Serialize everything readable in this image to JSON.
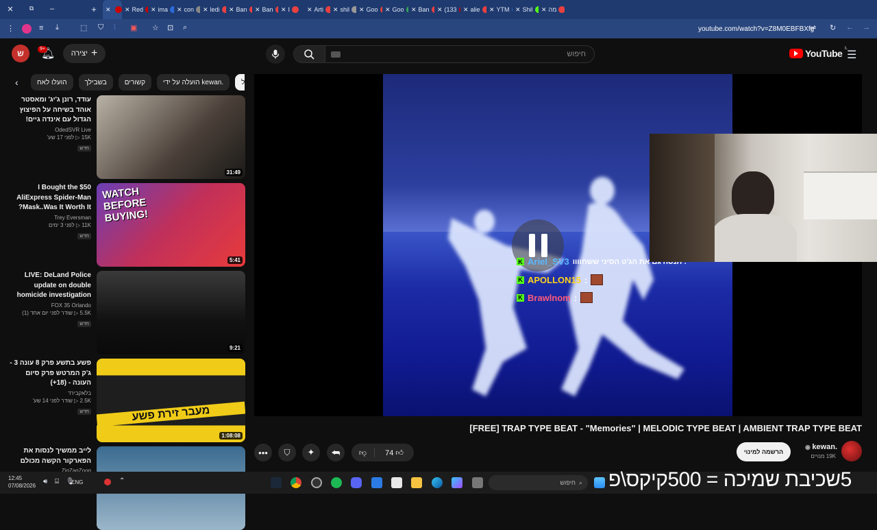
{
  "browser": {
    "tabs": [
      {
        "label": ""
      },
      {
        "label": "Red"
      },
      {
        "label": "ima"
      },
      {
        "label": "con"
      },
      {
        "label": "ledi"
      },
      {
        "label": "Ban"
      },
      {
        "label": "Ban"
      },
      {
        "label": "I"
      },
      {
        "label": "Arti"
      },
      {
        "label": "shil"
      },
      {
        "label": "Goo"
      },
      {
        "label": "Goo"
      },
      {
        "label": "Ban"
      },
      {
        "label": "(133"
      },
      {
        "label": "alie"
      },
      {
        "label": "YTM"
      },
      {
        "label": "Shil"
      },
      {
        "label": "מה"
      }
    ],
    "url": "youtube.com/watch?v=Z8M0EBFBXfg"
  },
  "header": {
    "logo_text": "YouTube",
    "logo_region": "IL",
    "search_placeholder": "חיפוש",
    "create_label": "יצירה",
    "notif_count": "9+",
    "avatar_letter": "ש"
  },
  "chips": [
    "הכול",
    "הועלה על ידי kewan.",
    "קשורים",
    "בשבילך",
    "הועלו לאח"
  ],
  "recommendations": [
    {
      "title": "עודד, רונן ג'יג' ומאסטר אוהד בשיחה על הפיצוץ הגדול עם אינדה גיים!",
      "channel": "OdedSVR Live",
      "stats": "15K ▷ לפני 17 שע'",
      "badge": "חדש",
      "duration": "31:49"
    },
    {
      "title": "I Bought the $50 AliExpress Spider-Man Mask..Was It Worth It?",
      "channel": "Trey Eversman",
      "stats": "11K ▷ לפני 3 ימים",
      "badge": "חדש",
      "duration": "5:41"
    },
    {
      "title": "LIVE: DeLand Police update on double homicide investigation",
      "channel": "FOX 35 Orlando",
      "stats": "5.5K ▷ שודר לפני יום אחד (1)",
      "badge": "חדש",
      "duration": "9:21"
    },
    {
      "title": "פשע בתשע פרק 8 עונה 3 - ג'ק המרטש פרק סיום העונה - (18+)",
      "channel": "בלאקבירד",
      "stats": "2.5K ▷ שודר לפני 14 שע'",
      "badge": "חדש",
      "duration": "1:08:08"
    },
    {
      "title": "לייב ממשיך לנסות את הפארקור הקשה מכולם",
      "channel": "ZigZagZoog",
      "stats": "",
      "badge": "",
      "duration": ""
    }
  ],
  "thumb_text": {
    "watch": "WATCH",
    "before": "BEFORE",
    "buying": "BUYING!",
    "crime": "מעבר זירת פשע"
  },
  "stream_chat": [
    {
      "user": "Ariel_SV3",
      "msg": "תנסה גם את הג'ט הסיני ששחוווו :"
    },
    {
      "user": "APOLLON15",
      "msg": ":"
    },
    {
      "user": "Brawlnom",
      "msg": ":"
    }
  ],
  "video": {
    "title": "[FREE] TRAP TYPE BEAT - \"Memories\" | MELODIC TYPE BEAT | AMBIENT TRAP TYPE BEAT",
    "channel": "kewan.",
    "subscribers": "19K מנויים",
    "subscribe_label": "הרשמה למינוי",
    "likes": "74"
  },
  "taskbar": {
    "time": "12:45",
    "date": "07/08/2026",
    "lang": "ENG",
    "search_placeholder": "חיפוש"
  },
  "overlay_text": "5שכיבת שמיכה = 500קיקס\\פ",
  "colors": {
    "yt_red": "#ff0000",
    "bg": "#0f0f0f",
    "chrome_tab": "#1f3a6e",
    "kick_green": "#53fc18"
  }
}
